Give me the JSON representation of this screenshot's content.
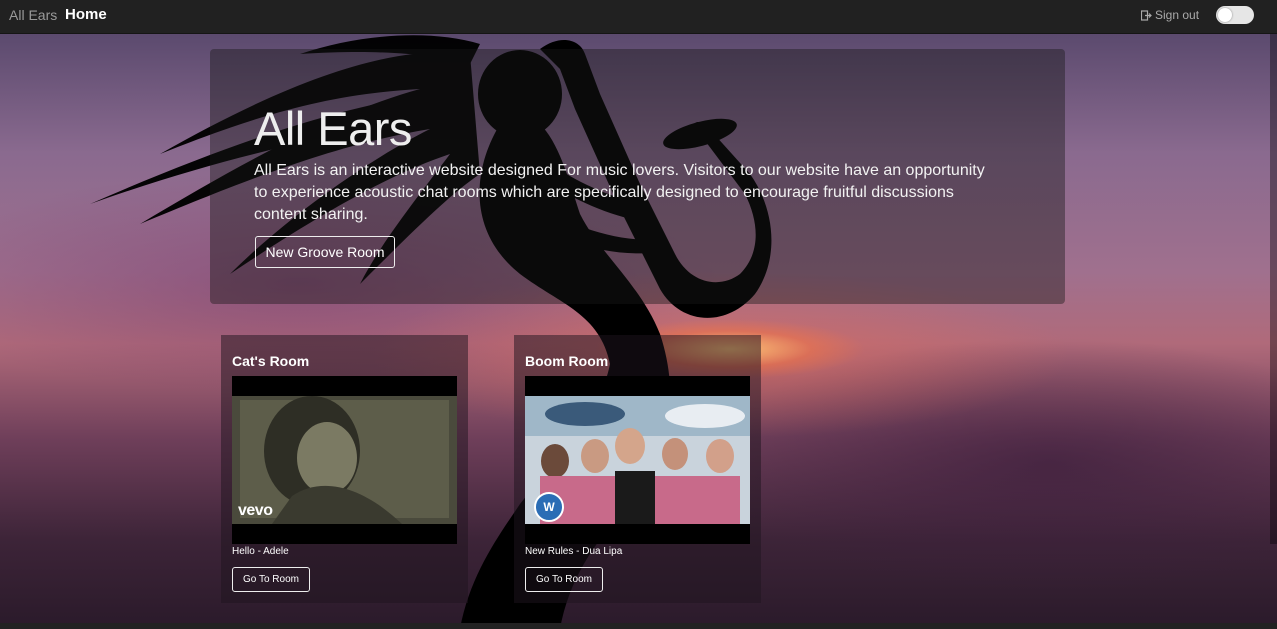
{
  "nav": {
    "brand": "All Ears",
    "home": "Home",
    "signout": "Sign out",
    "signout_icon": "sign-out-icon",
    "toggle_on": false
  },
  "hero": {
    "title": "All Ears",
    "description": "All Ears is an interactive website designed For music lovers. Visitors to our website have an opportunity to experience acoustic chat rooms which are specifically designed to encourage fruitful discussions content sharing.",
    "button": "New Groove Room"
  },
  "rooms": [
    {
      "title": "Cat's Room",
      "song": "Hello - Adele",
      "button": "Go To Room",
      "overlay": "vevo"
    },
    {
      "title": "Boom Room",
      "song": "New Rules - Dua Lipa",
      "button": "Go To Room",
      "overlay": "W"
    }
  ],
  "colors": {
    "navbar": "#212121",
    "hero_overlay": "rgba(25,25,25,0.42)"
  }
}
